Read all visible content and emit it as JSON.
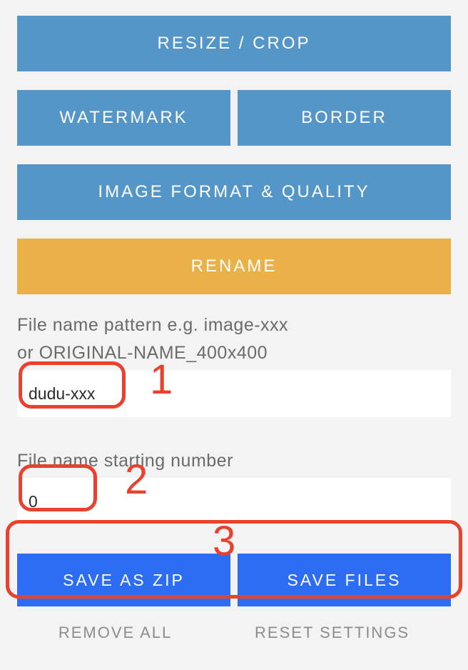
{
  "panels": {
    "resize_crop": "RESIZE / CROP",
    "watermark": "WATERMARK",
    "border": "BORDER",
    "format_quality": "IMAGE FORMAT & QUALITY",
    "rename": "RENAME"
  },
  "rename_section": {
    "pattern_label_line1": "File name pattern e.g. image-xxx",
    "pattern_label_line2": "or ORIGINAL-NAME_400x400",
    "pattern_value": "dudu-xxx",
    "start_label": "File name starting number",
    "start_value": "0"
  },
  "actions": {
    "save_zip": "SAVE AS ZIP",
    "save_files": "SAVE FILES",
    "remove_all": "REMOVE ALL",
    "reset_settings": "RESET SETTINGS"
  },
  "annotations": {
    "n1": "1",
    "n2": "2",
    "n3": "3"
  }
}
